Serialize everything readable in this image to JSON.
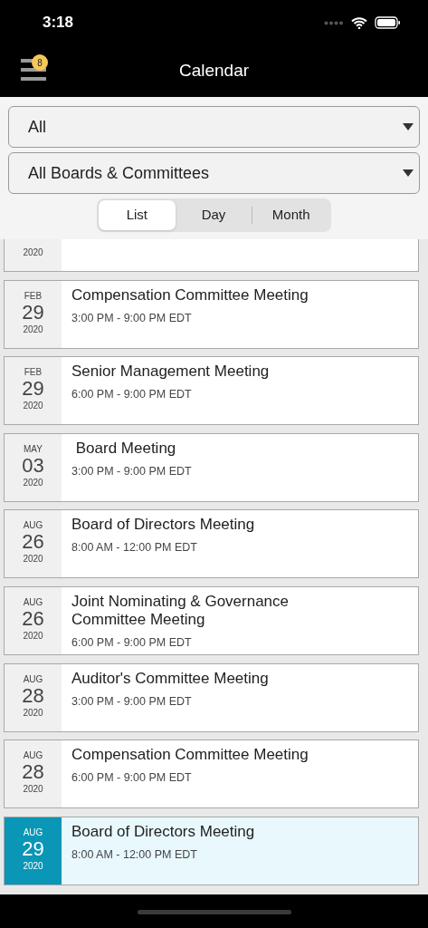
{
  "status_bar": {
    "time": "3:18"
  },
  "nav": {
    "title": "Calendar",
    "badge": "8"
  },
  "filters": [
    {
      "value": "All"
    },
    {
      "value": "All Boards & Committees"
    }
  ],
  "view_tabs": [
    {
      "label": "List",
      "selected": true
    },
    {
      "label": "Day",
      "selected": false
    },
    {
      "label": "Month",
      "selected": false
    }
  ],
  "events": [
    {
      "year": "2020",
      "selected": false
    },
    {
      "month": "FEB",
      "day": "29",
      "year": "2020",
      "title": "Compensation Committee Meeting",
      "time": "3:00 PM - 9:00 PM EDT",
      "selected": false
    },
    {
      "month": "FEB",
      "day": "29",
      "year": "2020",
      "title": "Senior Management Meeting",
      "time": "6:00 PM - 9:00 PM EDT",
      "selected": false
    },
    {
      "month": "MAY",
      "day": "03",
      "year": "2020",
      "title": " Board Meeting",
      "time": "3:00 PM - 9:00 PM EDT",
      "selected": false
    },
    {
      "month": "AUG",
      "day": "26",
      "year": "2020",
      "title": "Board of Directors Meeting",
      "time": "8:00 AM - 12:00 PM EDT",
      "selected": false
    },
    {
      "month": "AUG",
      "day": "26",
      "year": "2020",
      "title": "Joint Nominating & Governance Committee Meeting",
      "time": "6:00 PM - 9:00 PM EDT",
      "selected": false
    },
    {
      "month": "AUG",
      "day": "28",
      "year": "2020",
      "title": "Auditor's Committee Meeting",
      "time": "3:00 PM - 9:00 PM EDT",
      "selected": false
    },
    {
      "month": "AUG",
      "day": "28",
      "year": "2020",
      "title": "Compensation Committee Meeting",
      "time": "6:00 PM - 9:00 PM EDT",
      "selected": false
    },
    {
      "month": "AUG",
      "day": "29",
      "year": "2020",
      "title": "Board of Directors Meeting",
      "time": "8:00 AM - 12:00 PM EDT",
      "selected": true
    }
  ]
}
